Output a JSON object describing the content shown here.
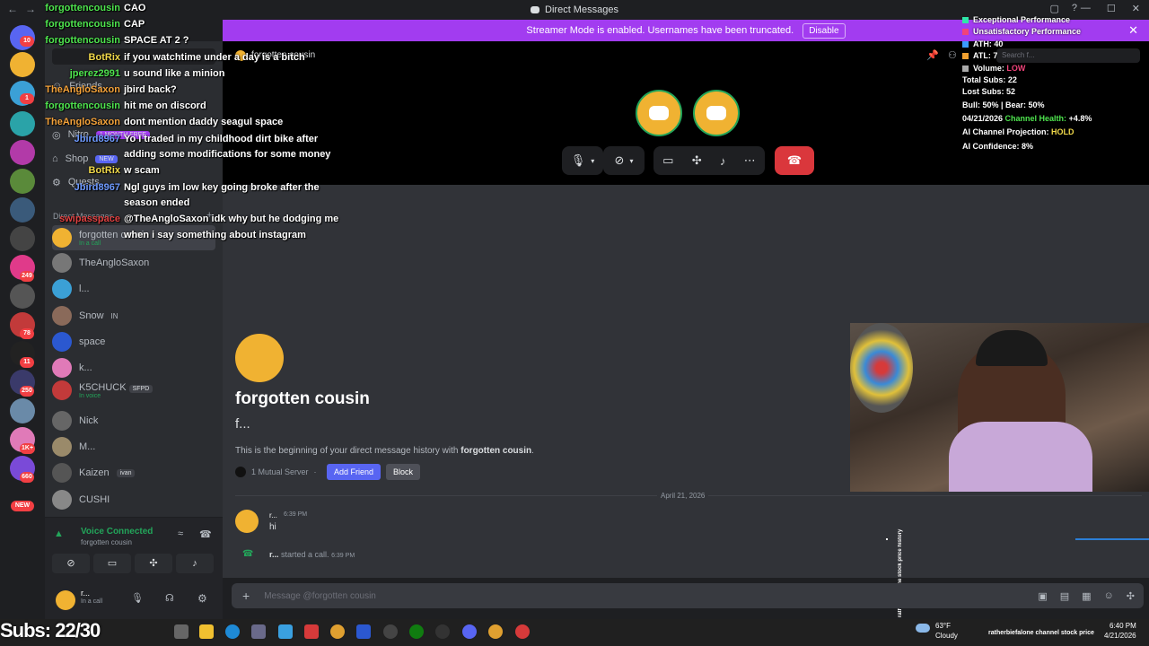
{
  "window": {
    "title": "Direct Messages"
  },
  "banner": {
    "text": "Streamer Mode is enabled. Usernames have been truncated.",
    "disable_label": "Disable"
  },
  "sidebar": {
    "friends": "Friends",
    "nitro": "Nitro",
    "nitro_badge": "1 MONTH FREE",
    "shop": "Shop",
    "shop_badge": "NEW",
    "quests": "Quests",
    "dm_header": "Direct Messages",
    "dms": [
      {
        "name": "forgotten cousin",
        "status": "In a call"
      },
      {
        "name": "TheAngloSaxon",
        "status": ""
      },
      {
        "name": "l...",
        "status": ""
      },
      {
        "name": "Snow",
        "tag": "IN",
        "status": ""
      },
      {
        "name": "space",
        "status": ""
      },
      {
        "name": "k...",
        "status": ""
      },
      {
        "name": "K5CHUCK",
        "tag": "SFPD",
        "status": "In voice"
      },
      {
        "name": "Nick",
        "status": ""
      },
      {
        "name": "M...",
        "status": ""
      },
      {
        "name": "Kaizen",
        "tag": "ivan",
        "status": ""
      },
      {
        "name": "CUSHI",
        "status": ""
      }
    ],
    "guild_badges": [
      "10",
      "1",
      "249",
      "78",
      "11",
      "250",
      "1K+",
      "660",
      "NEW",
      "9"
    ]
  },
  "voice": {
    "title": "Voice Connected",
    "channel": "forgotten cousin"
  },
  "user": {
    "name": "r...",
    "status": "In a call"
  },
  "header": {
    "dm_title": "forgotten cousin",
    "search_placeholder": "Search f..."
  },
  "profile": {
    "name": "forgotten cousin",
    "handle": "f...",
    "intro_prefix": "This is the beginning of your direct message history with ",
    "intro_name": "forgotten cousin",
    "intro_suffix": ".",
    "mutual": "1 Mutual Server",
    "add_friend": "Add Friend",
    "block": "Block"
  },
  "messages": {
    "date_divider": "April 21, 2026",
    "items": [
      {
        "author": "r...",
        "time": "6:39 PM",
        "text": "hi"
      },
      {
        "author": "r...",
        "text": "started a call.",
        "time": "6:39 PM"
      }
    ]
  },
  "composer": {
    "placeholder": "Message @forgotten cousin"
  },
  "overlay_chat": [
    {
      "user": "forgottencousin",
      "msg": "CAO",
      "color": "green"
    },
    {
      "user": "forgottencousin",
      "msg": "CAP",
      "color": "green"
    },
    {
      "user": "forgottencousin",
      "msg": "SPACE AT 2 ?",
      "color": "green"
    },
    {
      "user": "BotRix",
      "msg": "if you watchtime under a day is a bitch",
      "color": "gold"
    },
    {
      "user": "jperez2991",
      "msg": "u sound like a minion",
      "color": "green"
    },
    {
      "user": "TheAngloSaxon",
      "msg": "jbird back?",
      "color": "orange"
    },
    {
      "user": "forgottencousin",
      "msg": "hit me on discord",
      "color": "green"
    },
    {
      "user": "TheAngloSaxon",
      "msg": "dont mention daddy seagul space",
      "color": "orange"
    },
    {
      "user": "Jbird8967",
      "msg": "Yo I traded in my childhood dirt bike after",
      "color": "blue"
    },
    {
      "user": "",
      "msg": "adding some modifications for some money",
      "color": ""
    },
    {
      "user": "BotRix",
      "msg": "w scam",
      "color": "gold"
    },
    {
      "user": "Jbird8967",
      "msg": "Ngl guys im low key going broke after the",
      "color": "blue"
    },
    {
      "user": "",
      "msg": "season ended",
      "color": ""
    },
    {
      "user": "swipasspace",
      "msg": "@TheAngloSaxon idk why but he dodging me",
      "color": "red"
    },
    {
      "user": "",
      "msg": "when i say something about instagram",
      "color": ""
    }
  ],
  "stats": {
    "legend": [
      {
        "label": "Exceptional Performance",
        "color": "#2ee6a8"
      },
      {
        "label": "Unsatisfactory Performance",
        "color": "#f0437a"
      }
    ],
    "ath": "ATH: 40",
    "atl": "ATL: 7",
    "volume_label": "Volume: ",
    "volume_value": "LOW",
    "total_subs": "Total Subs: 22",
    "lost_subs": "Lost Subs: 52",
    "bull_bear": "Bull: 50% | Bear: 50%",
    "date": "04/21/2026 ",
    "health_label": "Channel Health: ",
    "health_value": "+4.8%",
    "projection_label": "AI Channel Projection: ",
    "projection_value": "HOLD",
    "confidence": "AI Confidence: 8%"
  },
  "ticker": {
    "vertical": "ratherbiefalone stock price history",
    "bottom": "ratherbiefalone channel stock price"
  },
  "subs_counter": "Subs: 22/30",
  "taskbar": {
    "weather_temp": "63°F",
    "weather_desc": "Cloudy",
    "time": "6:40 PM",
    "date": "4/21/2026"
  }
}
